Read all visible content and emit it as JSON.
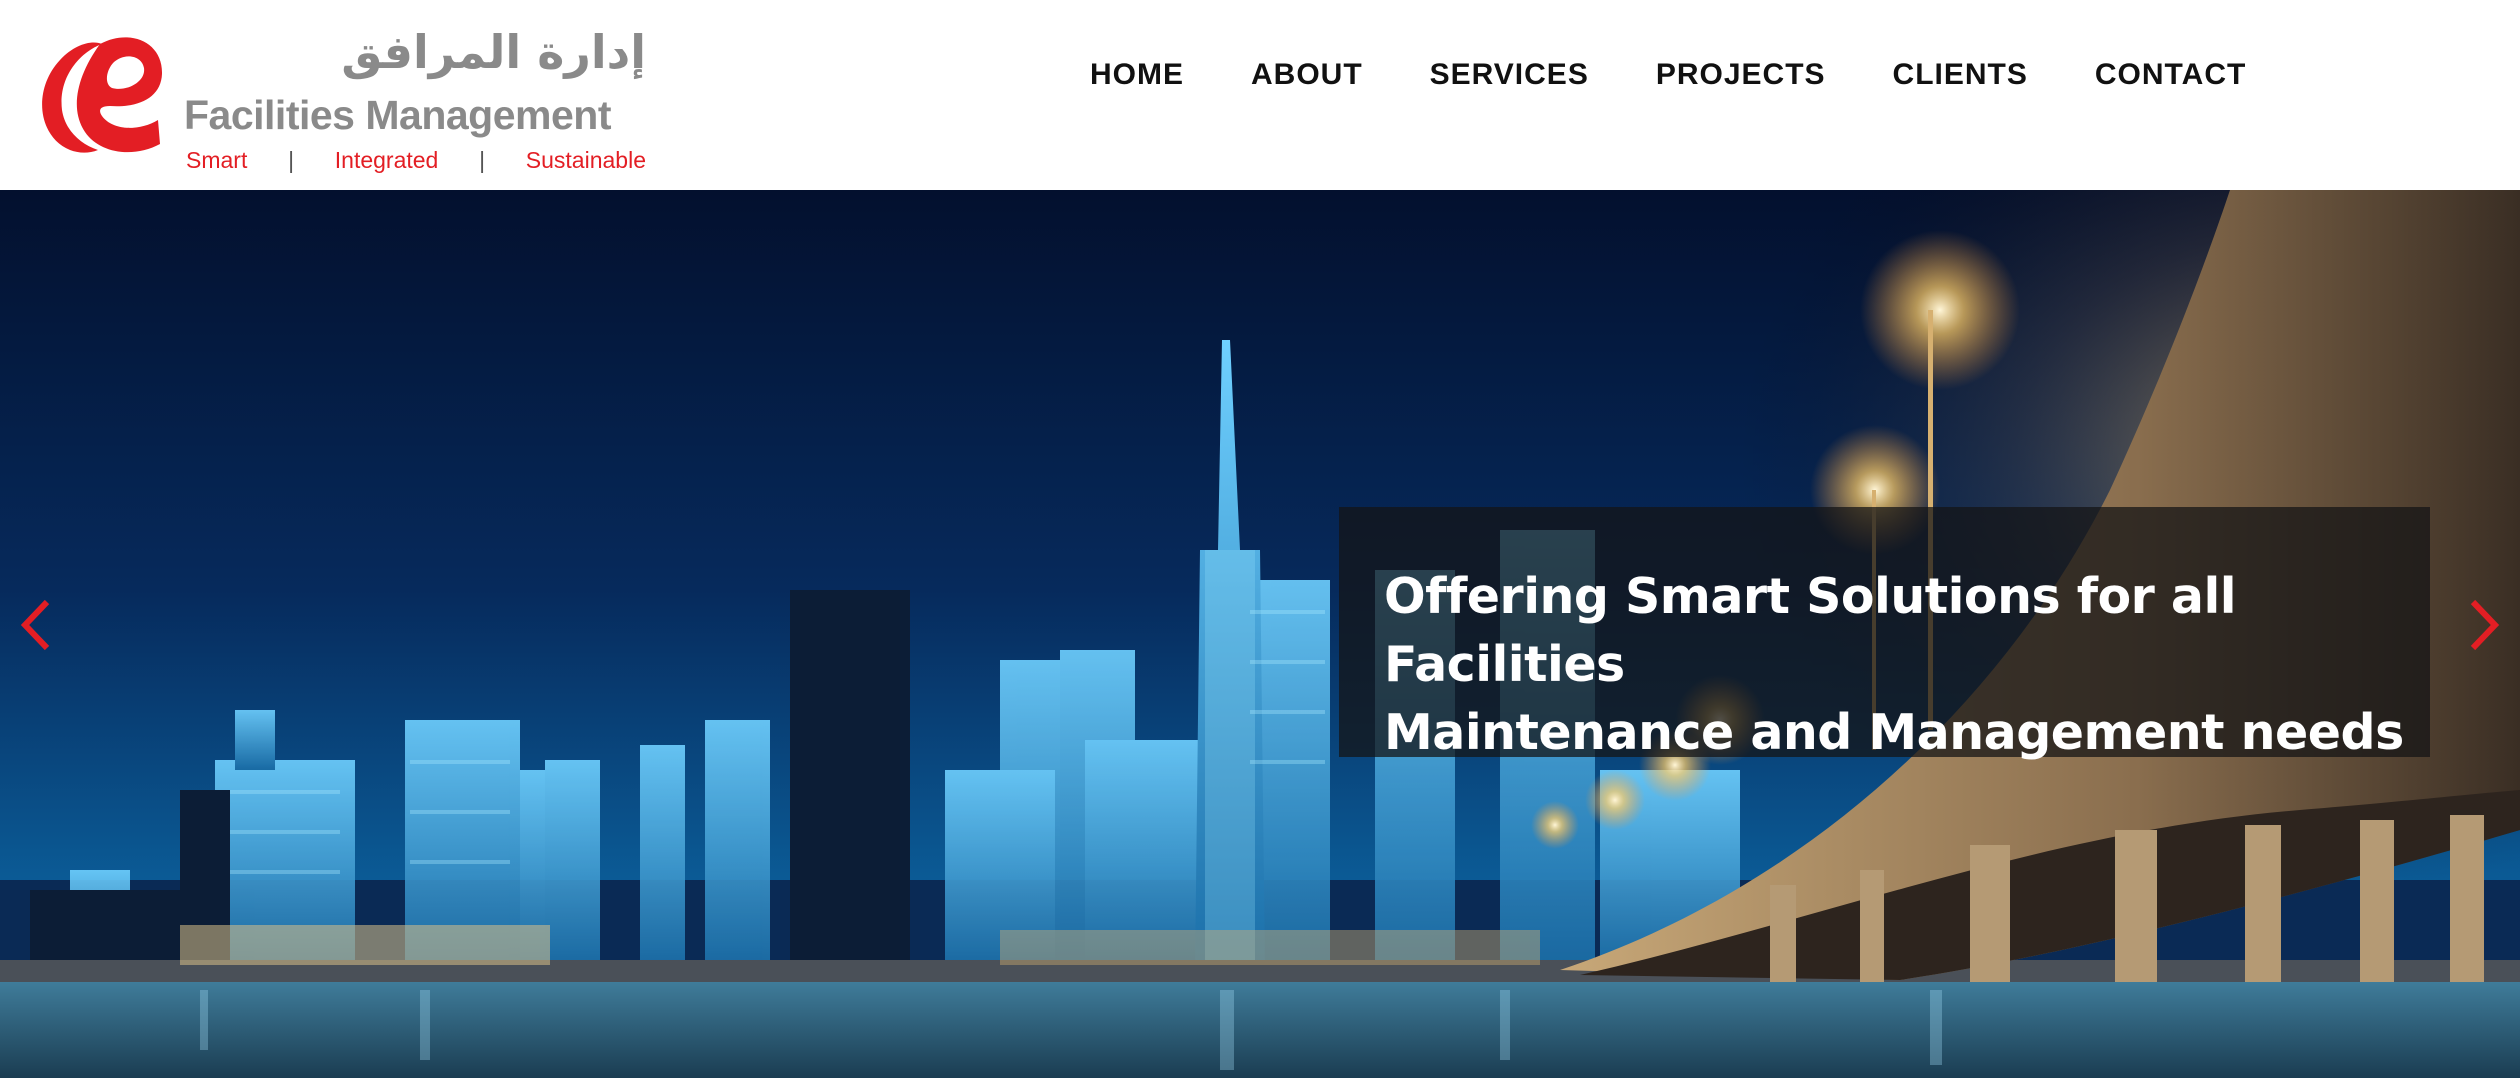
{
  "brand": {
    "arabic_name": "إدارة المرافق",
    "english_name": "Facilities Management",
    "tagline": [
      "Smart",
      "Integrated",
      "Sustainable"
    ],
    "tagline_separator": "|",
    "logo_icon": "stylized-e-logo",
    "primary_color": "#e31e24",
    "text_color": "#8a8a8a"
  },
  "nav": {
    "items": [
      {
        "label": "HOME"
      },
      {
        "label": "ABOUT"
      },
      {
        "label": "SERVICES"
      },
      {
        "label": "PROJECTS"
      },
      {
        "label": "CLIENTS"
      },
      {
        "label": "CONTACT"
      }
    ]
  },
  "hero": {
    "caption_line1": "Offering Smart Solutions for all Facilities",
    "caption_line2": "Maintenance and Management needs",
    "prev_icon": "chevron-left-icon",
    "next_icon": "chevron-right-icon",
    "arrow_color": "#e31e24",
    "background": "night-city-skyline-with-bridge"
  }
}
